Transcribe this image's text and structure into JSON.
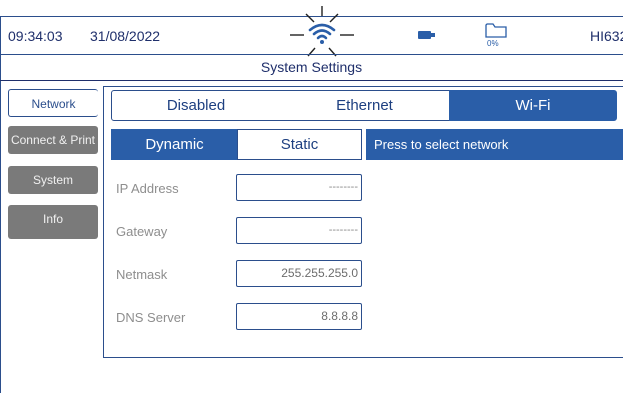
{
  "status": {
    "time": "09:34:03",
    "date": "31/08/2022",
    "battery_percent": "0%",
    "device_id": "HI632"
  },
  "title": "System Settings",
  "sidebar": {
    "tabs": [
      {
        "label": "Network"
      },
      {
        "label": "Connect & Print"
      },
      {
        "label": "System"
      },
      {
        "label": "Info"
      }
    ]
  },
  "connection": {
    "options": [
      "Disabled",
      "Ethernet",
      "Wi-Fi"
    ],
    "selected": "Wi-Fi"
  },
  "ip_mode": {
    "options": [
      "Dynamic",
      "Static"
    ],
    "selected": "Dynamic"
  },
  "network_button": "Press to select network",
  "fields": [
    {
      "label": "IP Address",
      "value": "--------"
    },
    {
      "label": "Gateway",
      "value": "--------"
    },
    {
      "label": "Netmask",
      "value": "255.255.255.0"
    },
    {
      "label": "DNS Server",
      "value": "8.8.8.8"
    }
  ],
  "colors": {
    "accent": "#2a5ea8",
    "frame": "#2b4e8c",
    "grey_tab": "#7a7a7a"
  }
}
